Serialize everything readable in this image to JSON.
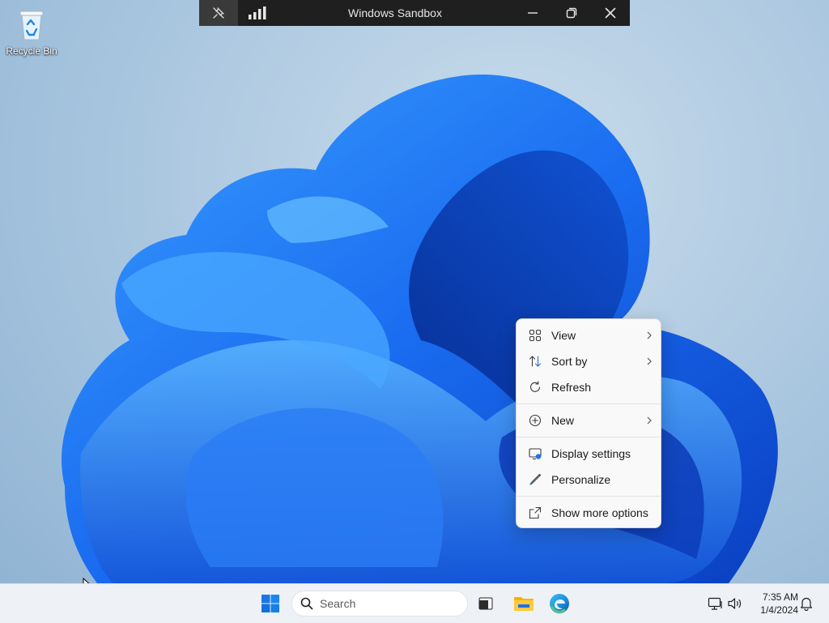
{
  "desktop": {
    "icons": [
      {
        "label": "Recycle Bin",
        "icon": "recycle-bin-icon"
      }
    ]
  },
  "sandbox_window": {
    "title": "Windows Sandbox",
    "buttons": [
      "pin-icon",
      "connection-bars-icon",
      "minimize-icon",
      "restore-icon",
      "close-icon"
    ]
  },
  "context_menu": {
    "items": [
      {
        "label": "View",
        "icon": "grid-view-icon",
        "submenu": true
      },
      {
        "label": "Sort by",
        "icon": "sort-icon",
        "submenu": true
      },
      {
        "label": "Refresh",
        "icon": "refresh-icon",
        "submenu": false
      },
      {
        "label": "New",
        "icon": "plus-circle-icon",
        "submenu": true
      },
      {
        "label": "Display settings",
        "icon": "display-settings-icon",
        "submenu": false
      },
      {
        "label": "Personalize",
        "icon": "pen-icon",
        "submenu": false
      },
      {
        "label": "Show more options",
        "icon": "external-link-icon",
        "submenu": false
      }
    ]
  },
  "taskbar": {
    "search_placeholder": "Search",
    "apps": [
      "start-icon",
      "task-view-icon",
      "file-explorer-icon",
      "edge-icon"
    ],
    "tray": [
      "network-icon",
      "volume-icon",
      "notification-bell-icon"
    ],
    "clock": {
      "time": "7:35 AM",
      "date": "1/4/2024"
    }
  },
  "colors": {
    "accent": "#0067c0",
    "bloom": "#1a6cf0",
    "taskbar": "#eef1f6",
    "sandbox_bar": "#1f1f1f"
  }
}
